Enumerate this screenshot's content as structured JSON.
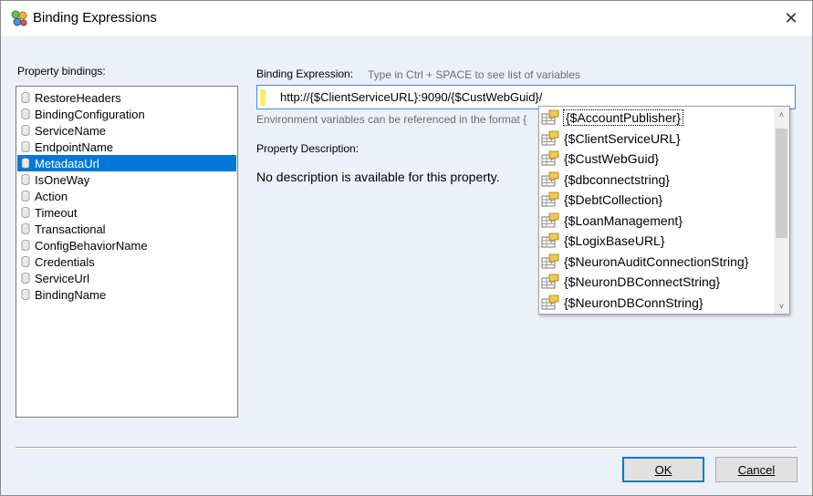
{
  "window": {
    "title": "Binding Expressions",
    "close_glyph": "✕"
  },
  "left": {
    "label": "Property bindings:",
    "items": [
      {
        "label": "RestoreHeaders"
      },
      {
        "label": "BindingConfiguration"
      },
      {
        "label": "ServiceName"
      },
      {
        "label": "EndpointName"
      },
      {
        "label": "MetadataUrl",
        "selected": true
      },
      {
        "label": "IsOneWay"
      },
      {
        "label": "Action"
      },
      {
        "label": "Timeout"
      },
      {
        "label": "Transactional"
      },
      {
        "label": "ConfigBehaviorName"
      },
      {
        "label": "Credentials"
      },
      {
        "label": "ServiceUrl"
      },
      {
        "label": "BindingName"
      }
    ]
  },
  "expression": {
    "label": "Binding Expression:",
    "hint": "Type in Ctrl + SPACE to see list of variables",
    "value": "http://{$ClientServiceURL}:9090/{$CustWebGuid}/",
    "env_hint": "Environment variables can be referenced in the format {"
  },
  "description": {
    "label": "Property Description:",
    "text": "No description is available for this property."
  },
  "autocomplete": {
    "items": [
      {
        "label": "{$AccountPublisher}"
      },
      {
        "label": "{$ClientServiceURL}"
      },
      {
        "label": "{$CustWebGuid}"
      },
      {
        "label": "{$dbconnectstring}"
      },
      {
        "label": "{$DebtCollection}"
      },
      {
        "label": "{$LoanManagement}"
      },
      {
        "label": "{$LogixBaseURL}"
      },
      {
        "label": "{$NeuronAuditConnectionString}"
      },
      {
        "label": "{$NeuronDBConnectString}"
      },
      {
        "label": "{$NeuronDBConnString}"
      }
    ],
    "scroll_up": "˄",
    "scroll_down": "˅"
  },
  "buttons": {
    "ok": "OK",
    "cancel": "Cancel"
  },
  "colors": {
    "selection": "#0078d7",
    "accent_border": "#0078d7",
    "caret_highlight": "#ffec75"
  }
}
